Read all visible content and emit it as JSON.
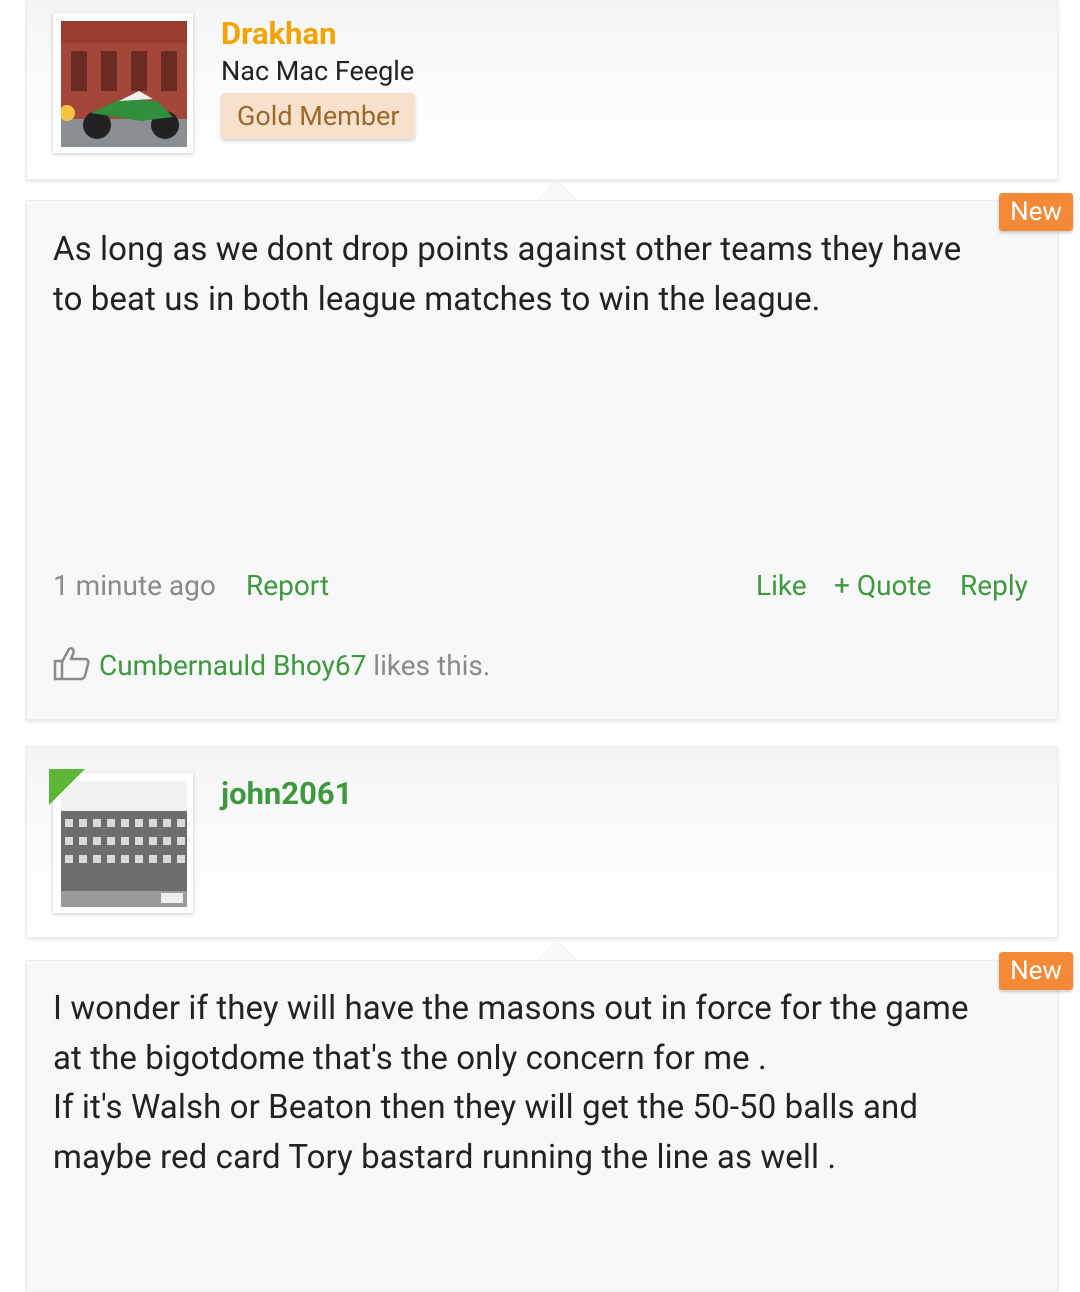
{
  "posts": [
    {
      "author": {
        "name": "Drakhan",
        "name_color": "#f5a300",
        "title": "Nac Mac Feegle",
        "badge": "Gold Member"
      },
      "new_label": "New",
      "body": "As long as we dont drop points against other teams they have to beat us in both league matches to win the league.",
      "timestamp": "1 minute ago",
      "actions": {
        "report": "Report",
        "like": "Like",
        "quote": "+ Quote",
        "reply": "Reply"
      },
      "likes": {
        "icon": "thumbs-up-icon",
        "user": "Cumbernauld Bhoy67",
        "suffix": " likes this."
      }
    },
    {
      "author": {
        "name": "john2061",
        "name_color": "#3c9a3c"
      },
      "new_label": "New",
      "body": "I wonder if they will have the masons out in force for the game at the bigotdome that's the only concern for me .\nIf it's Walsh or Beaton then they will get the 50-50 balls and maybe red card Tory bastard running the line as well ."
    }
  ]
}
